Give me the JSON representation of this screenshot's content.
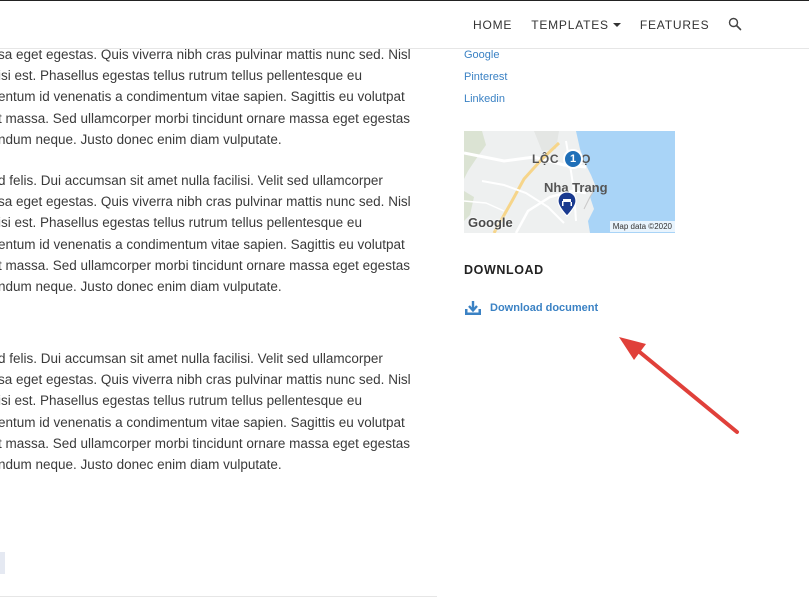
{
  "nav": {
    "items": [
      {
        "label": "HOME"
      },
      {
        "label": "TEMPLATES"
      },
      {
        "label": "FEATURES"
      }
    ]
  },
  "article": {
    "paragraphs": [
      [
        "sa eget egestas. Quis viverra nibh cras pulvinar mattis nunc sed. Nisl",
        "isi est. Phasellus egestas tellus rutrum tellus pellentesque eu",
        "entum id venenatis a condimentum vitae sapien. Sagittis eu volutpat",
        "t massa. Sed ullamcorper morbi tincidunt ornare massa eget egestas",
        "ndum neque. Justo donec enim diam vulputate."
      ],
      [
        "d felis. Dui accumsan sit amet nulla facilisi. Velit sed ullamcorper",
        "sa eget egestas. Quis viverra nibh cras pulvinar mattis nunc sed. Nisl",
        "isi est. Phasellus egestas tellus rutrum tellus pellentesque eu",
        "entum id venenatis a condimentum vitae sapien. Sagittis eu volutpat",
        "t massa. Sed ullamcorper morbi tincidunt ornare massa eget egestas",
        "ndum neque. Justo donec enim diam vulputate."
      ],
      [
        "d felis. Dui accumsan sit amet nulla facilisi. Velit sed ullamcorper",
        "sa eget egestas. Quis viverra nibh cras pulvinar mattis nunc sed. Nisl",
        "isi est. Phasellus egestas tellus rutrum tellus pellentesque eu",
        "entum id venenatis a condimentum vitae sapien. Sagittis eu volutpat",
        "t massa. Sed ullamcorper morbi tincidunt ornare massa eget egestas",
        "ndum neque. Justo donec enim diam vulputate."
      ]
    ]
  },
  "sidebar": {
    "social_links": [
      {
        "label": "Google"
      },
      {
        "label": "Pinterest"
      },
      {
        "label": "Linkedin"
      }
    ],
    "map": {
      "district_label": "LỘC",
      "district_label_2": "Ọ",
      "marker_number": "1",
      "city_label": "Nha Trang",
      "google_logo": "Google",
      "attribution": "Map data ©2020"
    },
    "download": {
      "title": "DOWNLOAD",
      "link_label": "Download document"
    }
  },
  "colors": {
    "link": "#3b82c4",
    "annotation_arrow": "#e0403a",
    "water": "#a9d4f7",
    "land": "#eef0f0"
  }
}
